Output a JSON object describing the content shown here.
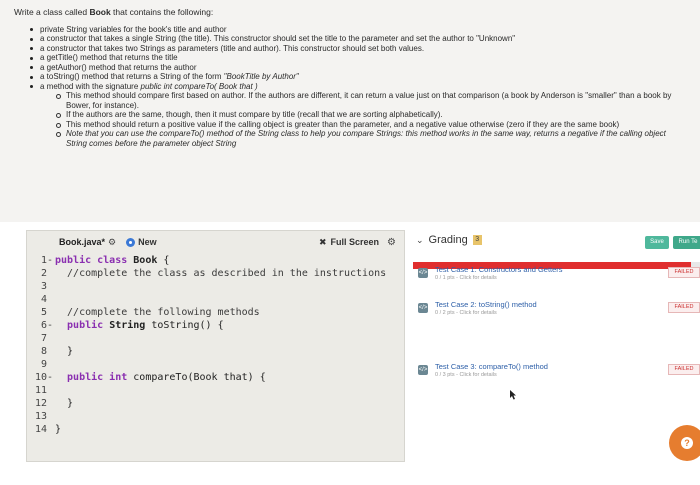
{
  "instructions": {
    "intro_prefix": "Write a class called ",
    "intro_class": "Book",
    "intro_suffix": " that contains the following:",
    "items": [
      "private String variables for the book's title and author",
      "a constructor that takes a single String (the title). This constructor should set the title to the parameter and set the author to \"Unknown\"",
      "a constructor that takes two Strings as parameters (title and author). This constructor should set both values.",
      "a getTitle() method that returns the title",
      "a getAuthor() method that returns the author",
      "a toString() method that returns a String of the form \"BookTitle by Author\"",
      "a method with the signature public int compareTo( Book that )"
    ],
    "item6_prefix": "a toString() method that returns a String of the form ",
    "item6_italic": "\"BookTitle by Author\"",
    "item7_prefix": "a method with the signature ",
    "item7_italic": "public int compareTo( Book that )",
    "subitems": [
      "This method should compare first based on author. If the authors are different, it can return a value just on that comparison (a book by Anderson is \"smaller\" than a book by Bower, for instance).",
      "If the authors are the same, though, then it must compare by title (recall that we are sorting alphabetically).",
      "This method should return a positive value if the calling object is greater than the parameter, and a negative value otherwise (zero if they are the same book)",
      "Note that you can use the compareTo() method of the String class to help you compare Strings: this method works in the same way, returns a negative if the calling object String comes before the parameter object String"
    ]
  },
  "editor": {
    "file_tab": "Book.java*",
    "new_label": "New",
    "fullscreen_label": "Full Screen",
    "lines": [
      {
        "n": "1",
        "fold": "-",
        "parts": [
          [
            "kw",
            "public class "
          ],
          [
            "cls",
            "Book "
          ],
          [
            "code",
            "{"
          ]
        ]
      },
      {
        "n": "2",
        "fold": "",
        "parts": [
          [
            "cm",
            "  //complete the class as described in the instructions"
          ]
        ]
      },
      {
        "n": "3",
        "fold": "",
        "parts": []
      },
      {
        "n": "4",
        "fold": "",
        "parts": []
      },
      {
        "n": "5",
        "fold": "",
        "parts": [
          [
            "cm",
            "  //complete the following methods"
          ]
        ]
      },
      {
        "n": "6",
        "fold": "-",
        "parts": [
          [
            "kw",
            "  public "
          ],
          [
            "cls",
            "String "
          ],
          [
            "code",
            "toString() {"
          ]
        ]
      },
      {
        "n": "7",
        "fold": "",
        "parts": []
      },
      {
        "n": "8",
        "fold": "",
        "parts": [
          [
            "code",
            "  }"
          ]
        ]
      },
      {
        "n": "9",
        "fold": "",
        "parts": []
      },
      {
        "n": "10",
        "fold": "-",
        "parts": [
          [
            "kw",
            "  public int "
          ],
          [
            "code",
            "compareTo(Book that) {"
          ]
        ]
      },
      {
        "n": "11",
        "fold": "",
        "parts": []
      },
      {
        "n": "12",
        "fold": "",
        "parts": [
          [
            "code",
            "  }"
          ]
        ]
      },
      {
        "n": "13",
        "fold": "",
        "parts": []
      },
      {
        "n": "14",
        "fold": "",
        "parts": [
          [
            "code",
            "}"
          ]
        ]
      }
    ]
  },
  "grading": {
    "title": "Grading",
    "badge": "3",
    "save_label": "Save",
    "run_label": "Run Te",
    "progress_fraction": 0.97,
    "tests": [
      {
        "icon": "</>",
        "title": "Test Case 1: Constructors and Getters",
        "sub": "0 / 1 pts - Click for details",
        "status": "FAILED"
      },
      {
        "icon": "</>",
        "title": "Test Case 2: toString() method",
        "sub": "0 / 2 pts - Click for details",
        "status": "FAILED"
      },
      {
        "icon": "</>",
        "title": "Test Case 3: compareTo() method",
        "sub": "0 / 3 pts - Click for details",
        "status": "FAILED"
      }
    ]
  },
  "help_label": "?",
  "colors": {
    "accent_green": "#4fb89c",
    "failed_red": "#e02e2e",
    "help_orange": "#e67d2f",
    "link_blue": "#2d5fa8"
  }
}
